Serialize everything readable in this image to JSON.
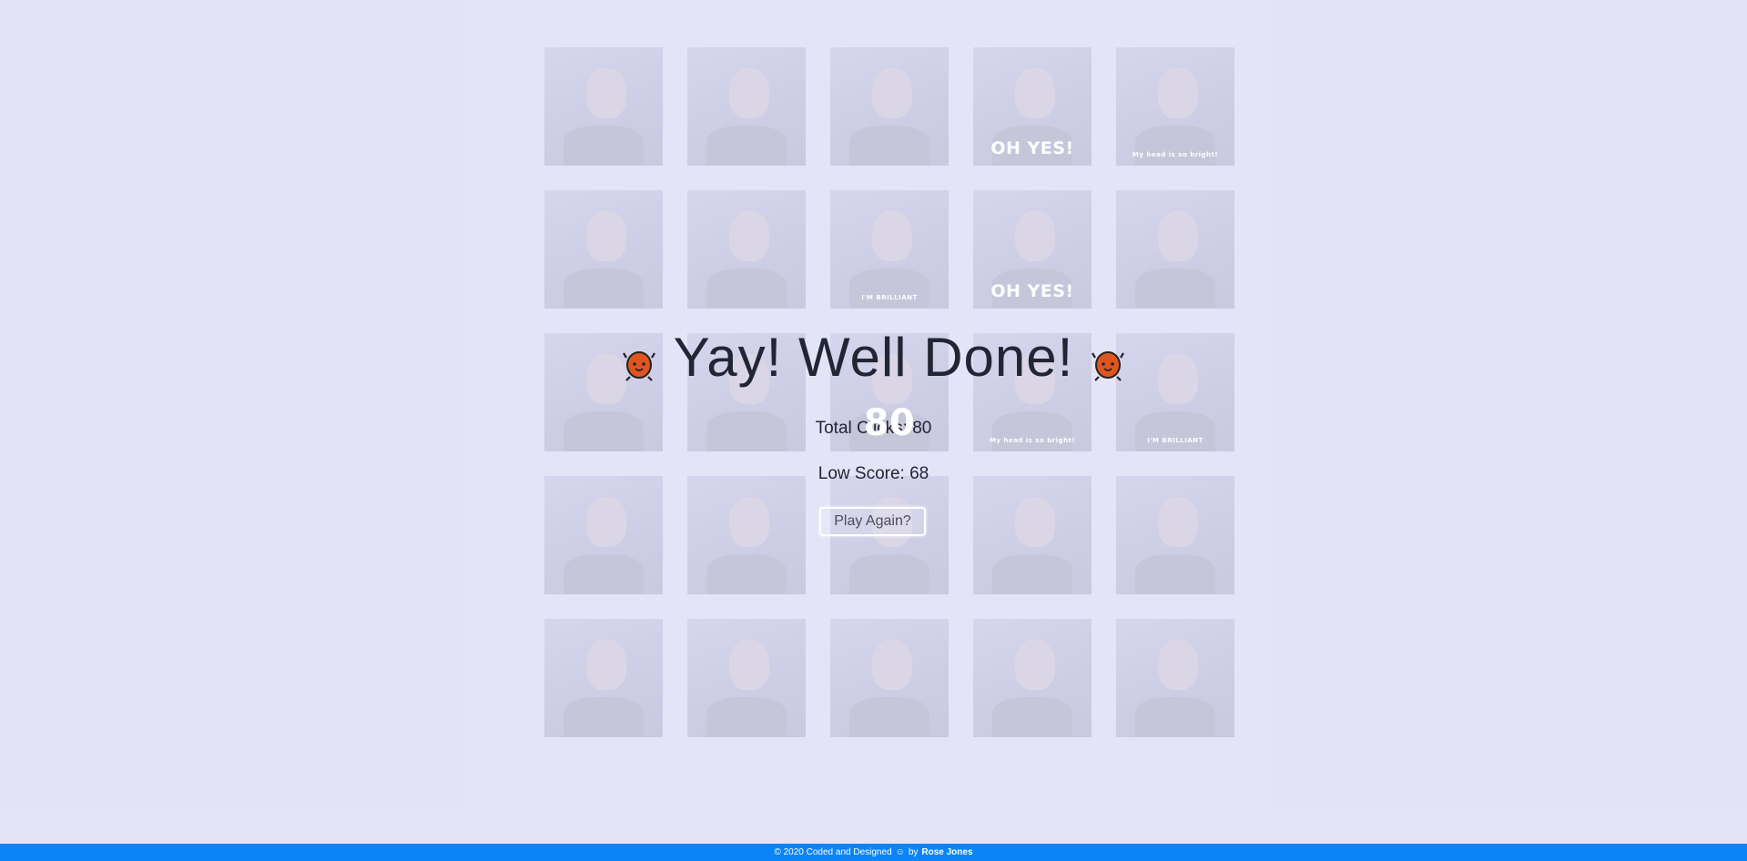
{
  "board": {
    "cards": [
      {
        "caption": "",
        "style": "small"
      },
      {
        "caption": "",
        "style": "small"
      },
      {
        "caption": "",
        "style": "small"
      },
      {
        "caption": "OH YES!",
        "style": "big"
      },
      {
        "caption": "My head is so bright!",
        "style": "small"
      },
      {
        "caption": "",
        "style": "small"
      },
      {
        "caption": "",
        "style": "small"
      },
      {
        "caption": "I'M BRILLIANT",
        "style": "small"
      },
      {
        "caption": "OH YES!",
        "style": "big"
      },
      {
        "caption": "",
        "style": "small"
      },
      {
        "caption": "",
        "style": "small"
      },
      {
        "caption": "",
        "style": "small"
      },
      {
        "caption": "80",
        "style": "num"
      },
      {
        "caption": "My head is so bright!",
        "style": "small"
      },
      {
        "caption": "I'M BRILLIANT",
        "style": "small"
      },
      {
        "caption": "",
        "style": "small"
      },
      {
        "caption": "",
        "style": "small"
      },
      {
        "caption": "",
        "style": "small"
      },
      {
        "caption": "",
        "style": "small"
      },
      {
        "caption": "",
        "style": "small"
      },
      {
        "caption": "",
        "style": "small"
      },
      {
        "caption": "",
        "style": "small"
      },
      {
        "caption": "",
        "style": "small"
      },
      {
        "caption": "",
        "style": "small"
      },
      {
        "caption": "",
        "style": "small"
      }
    ]
  },
  "win": {
    "title": "Yay! Well Done!",
    "total_clicks": "Total Clicks: 80",
    "low_score": "Low Score: 68",
    "play_again": "Play Again?",
    "mascot_icon": "orange-blob-mascot-icon",
    "mascot_color": "#e0551f"
  },
  "footer": {
    "copyright": "© 2020 Coded and Designed",
    "smiley": "☺",
    "by": "by",
    "author": "Rose Jones",
    "color": "#0a84f7"
  }
}
